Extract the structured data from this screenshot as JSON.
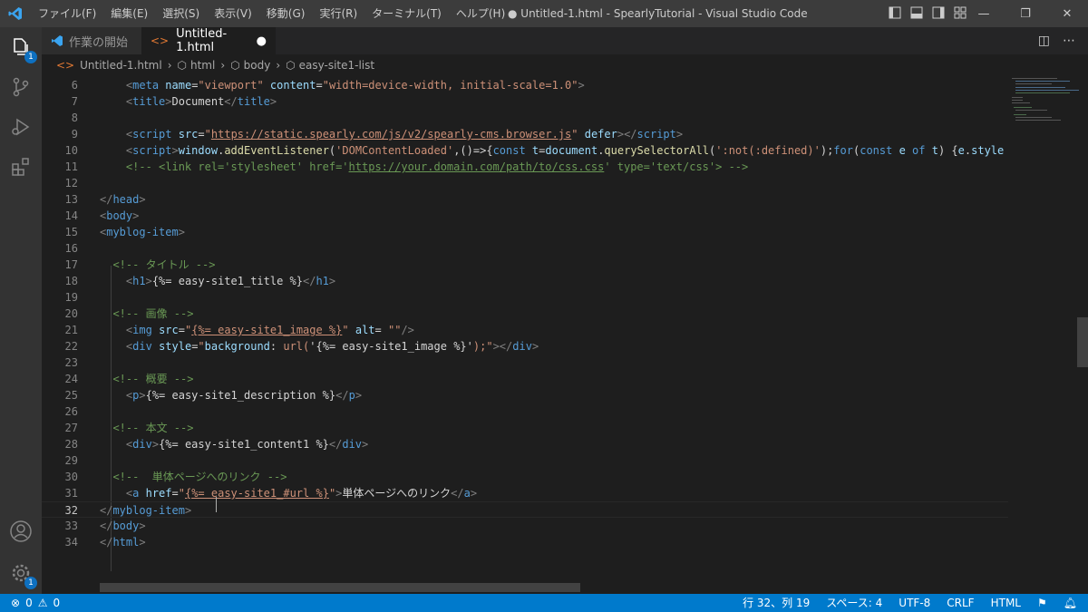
{
  "titlebar": {
    "menu": [
      "ファイル(F)",
      "編集(E)",
      "選択(S)",
      "表示(V)",
      "移動(G)",
      "実行(R)",
      "ターミナル(T)",
      "ヘルプ(H)"
    ],
    "title": "● Untitled-1.html - SpearlyTutorial - Visual Studio Code",
    "accent": "#3c3c3c"
  },
  "tabs": [
    {
      "label": "作業の開始"
    },
    {
      "label": "Untitled-1.html"
    }
  ],
  "breadcrumb": [
    "Untitled-1.html",
    "html",
    "body",
    "easy-site1-list"
  ],
  "activity": {
    "explorer_badge": "1",
    "settings_badge": "1"
  },
  "editor": {
    "line_numbers": [
      "6",
      "7",
      "8",
      "9",
      "10",
      "11",
      "12",
      "13",
      "14",
      "15",
      "16",
      "17",
      "18",
      "19",
      "20",
      "21",
      "22",
      "23",
      "24",
      "25",
      "26",
      "27",
      "28",
      "29",
      "30",
      "31",
      "32",
      "33",
      "34"
    ]
  },
  "status": {
    "errors": "0",
    "warnings": "0",
    "position": "行 32、列 19",
    "spaces": "スペース: 4",
    "encoding": "UTF-8",
    "eol": "CRLF",
    "language": "HTML",
    "accent": "#007acc"
  }
}
